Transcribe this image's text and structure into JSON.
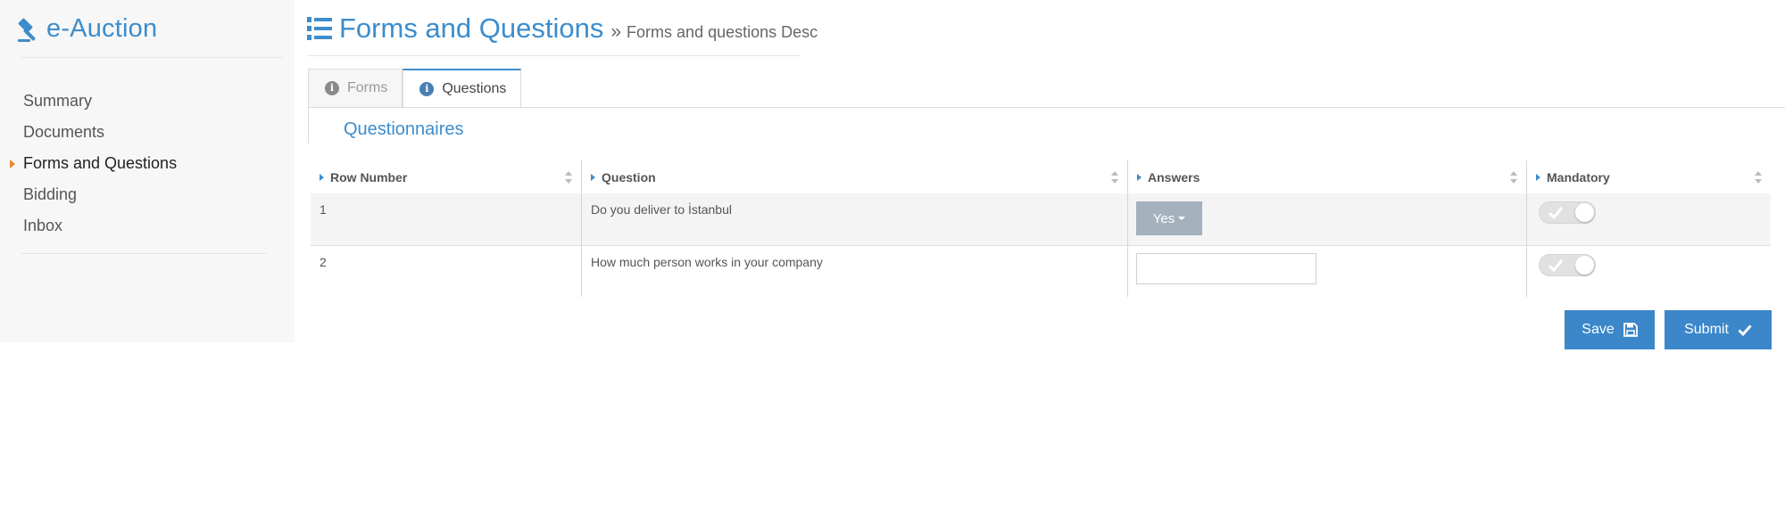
{
  "app": {
    "brand": "e-Auction"
  },
  "sidebar": {
    "items": [
      {
        "label": "Summary",
        "active": false
      },
      {
        "label": "Documents",
        "active": false
      },
      {
        "label": "Forms and Questions",
        "active": true
      },
      {
        "label": "Bidding",
        "active": false
      },
      {
        "label": "Inbox",
        "active": false
      }
    ]
  },
  "header": {
    "title": "Forms and Questions",
    "separator": "»",
    "breadcrumb": "Forms and questions Desc"
  },
  "tabs": [
    {
      "label": "Forms",
      "active": false
    },
    {
      "label": "Questions",
      "active": true
    }
  ],
  "section": {
    "title": "Questionnaires"
  },
  "table": {
    "columns": [
      "Row Number",
      "Question",
      "Answers",
      "Mandatory"
    ],
    "rows": [
      {
        "row_number": "1",
        "question": "Do you deliver to İstanbul",
        "answer_type": "select",
        "answer_value": "Yes",
        "mandatory": true
      },
      {
        "row_number": "2",
        "question": "How much person works in your company",
        "answer_type": "text",
        "answer_value": "",
        "mandatory": true
      }
    ]
  },
  "actions": {
    "save_label": "Save",
    "submit_label": "Submit"
  },
  "colors": {
    "accent": "#3c8dcc",
    "button": "#3b87c9",
    "active_marker": "#e8892b",
    "select_button": "#a5b1bd"
  }
}
